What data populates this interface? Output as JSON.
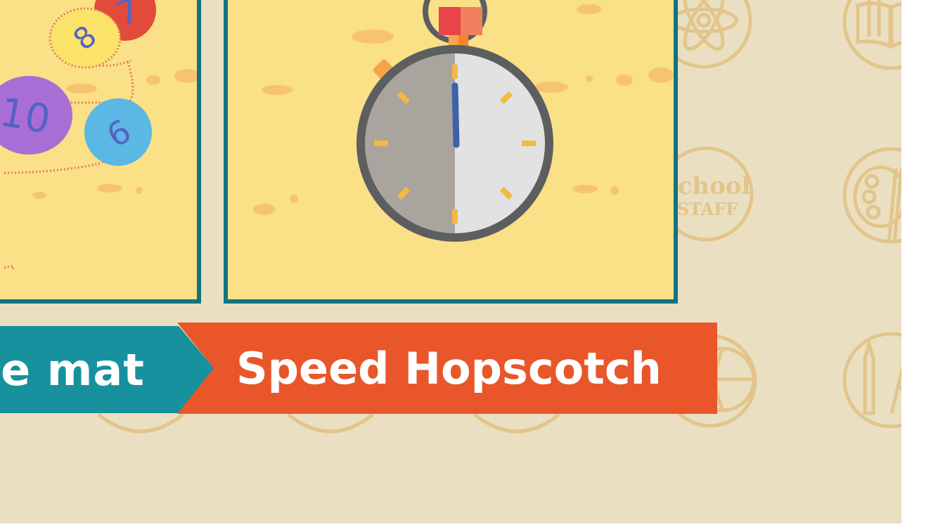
{
  "activities": {
    "left_label": "ne mat",
    "right_label": "Speed Hopscotch"
  },
  "number_mat": {
    "numbers": [
      "8",
      "10",
      "6",
      "7"
    ]
  },
  "background_icons": [
    "atom-icon",
    "book-icon",
    "school-staff-badge-icon",
    "art-palette-icon",
    "drafting-tools-icon",
    "globe-icon"
  ],
  "school_badge": {
    "line1": "school",
    "line2": "STAFF"
  },
  "colors": {
    "background": "#ebdfc1",
    "panel": "#fae086",
    "panel_border": "#107480",
    "teal_ribbon": "#17919e",
    "orange_ribbon": "#e8562a",
    "icon_stroke": "#e2c58b"
  }
}
